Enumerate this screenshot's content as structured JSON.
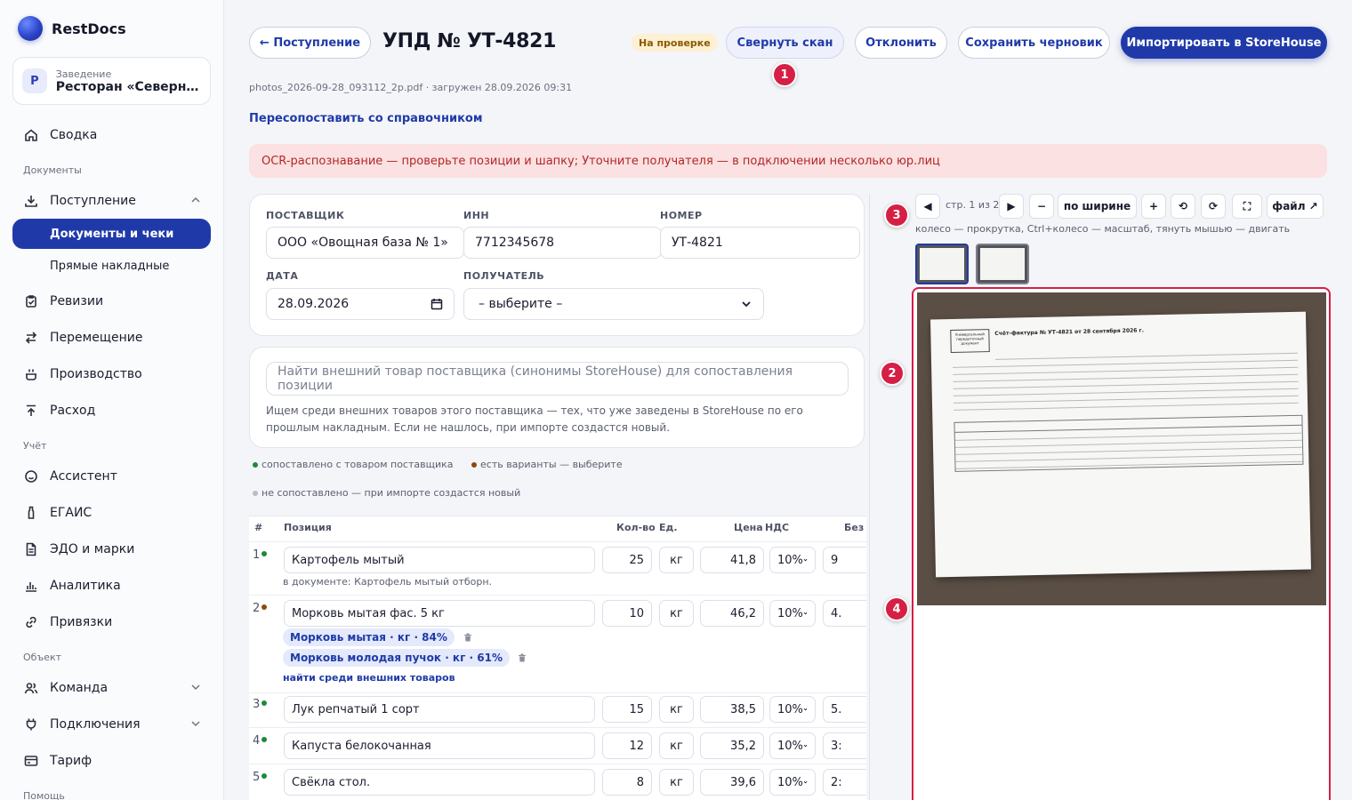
{
  "sidebar": {
    "brand": "RestDocs",
    "venue": {
      "avatar": "Р",
      "caption": "Заведение",
      "name": "Ресторан «Северный ..."
    },
    "dashboard": "Сводка",
    "section_documents": "Документы",
    "incoming": "Поступление",
    "sub_docs": "Документы и чеки",
    "sub_direct": "Прямые накладные",
    "revisions": "Ревизии",
    "transfer": "Перемещение",
    "production": "Производство",
    "expense": "Расход",
    "section_accounting": "Учёт",
    "assistant": "Ассистент",
    "egais": "ЕГАИС",
    "edo": "ЭДО и марки",
    "analytics": "Аналитика",
    "bindings": "Привязки",
    "section_object": "Объект",
    "team": "Команда",
    "connections": "Подключения",
    "tariff": "Тариф",
    "section_help": "Помощь"
  },
  "header": {
    "back": "← Поступление",
    "title": "УПД № УТ-4821",
    "status": "На проверке",
    "collapse_scan": "Свернуть скан",
    "reject": "Отклонить",
    "save_draft": "Сохранить черновик",
    "import": "Импортировать в StoreHouse",
    "file_meta": "photos_2026-09-28_093112_2p.pdf · загружен 28.09.2026 09:31",
    "remap": "Пересопоставить со справочником",
    "alert": "OCR-распознавание — проверьте позиции и шапку; Уточните получателя — в подключении несколько юр.лиц"
  },
  "markers": [
    "1",
    "2",
    "3",
    "4"
  ],
  "form": {
    "supplier_label": "ПОСТАВЩИК",
    "supplier": "ООО «Овощная база № 1»",
    "inn_label": "ИНН",
    "inn": "7712345678",
    "number_label": "НОМЕР",
    "number": "УТ-4821",
    "date_label": "ДАТА",
    "date": "28.09.2026",
    "recipient_label": "ПОЛУЧАТЕЛЬ",
    "recipient": "– выберите –"
  },
  "search": {
    "placeholder": "Найти внешний товар поставщика (синонимы StoreHouse) для сопоставления позиции",
    "help": "Ищем среди внешних товаров этого поставщика — тех, что уже заведены в StoreHouse по его прошлым накладным. Если не нашлось, при импорте создастся новый."
  },
  "legend": {
    "matched": "сопоставлено с товаром поставщика",
    "variants": "есть варианты — выберите",
    "unmatched": "не сопоставлено — при импорте создастся новый"
  },
  "table": {
    "headers": {
      "num": "#",
      "position": "Позиция",
      "qty": "Кол-во",
      "unit": "Ед.",
      "price": "Цена",
      "vat": "НДС",
      "novat": "Без"
    },
    "rows": [
      {
        "n": "1",
        "name": "Картофель мытый",
        "qty": "25",
        "unit": "кг",
        "price": "41,8",
        "vat": "10%",
        "novat": "9",
        "doc_note": "в документе: Картофель мытый отборн."
      },
      {
        "n": "2",
        "name": "Морковь мытая фас. 5 кг",
        "qty": "10",
        "unit": "кг",
        "price": "46,2",
        "vat": "10%",
        "novat": "4.",
        "chips": [
          "Морковь мытая · кг · 84%",
          "Морковь молодая пучок · кг · 61%"
        ],
        "find": "найти среди внешних товаров"
      },
      {
        "n": "3",
        "name": "Лук репчатый 1 сорт",
        "qty": "15",
        "unit": "кг",
        "price": "38,5",
        "vat": "10%",
        "novat": "5."
      },
      {
        "n": "4",
        "name": "Капуста белокочанная",
        "qty": "12",
        "unit": "кг",
        "price": "35,2",
        "vat": "10%",
        "novat": "3:"
      },
      {
        "n": "5",
        "name": "Свёкла стол.",
        "qty": "8",
        "unit": "кг",
        "price": "39,6",
        "vat": "10%",
        "novat": "2:"
      }
    ]
  },
  "viewer": {
    "prev": "◀",
    "page": "стр. 1 из 2",
    "next": "▶",
    "zoom_out": "−",
    "fit_width": "по ширине",
    "zoom_in": "+",
    "rotate_left": "⟲",
    "rotate_right": "⟳",
    "fullscreen": "⛶",
    "file": "файл ↗",
    "hint": "колесо — прокрутка, Ctrl+колесо — масштаб, тянуть мышью — двигать",
    "doc_box": "Универсальный передаточный документ",
    "doc_title": "Счёт-фактура № УТ-4821 от 28 сентября 2026 г."
  },
  "colors": {
    "accent": "#1f3aa8",
    "marker": "#d61f45",
    "alert_bg": "#fbe1e1",
    "status_bg": "#fdf0d3"
  }
}
